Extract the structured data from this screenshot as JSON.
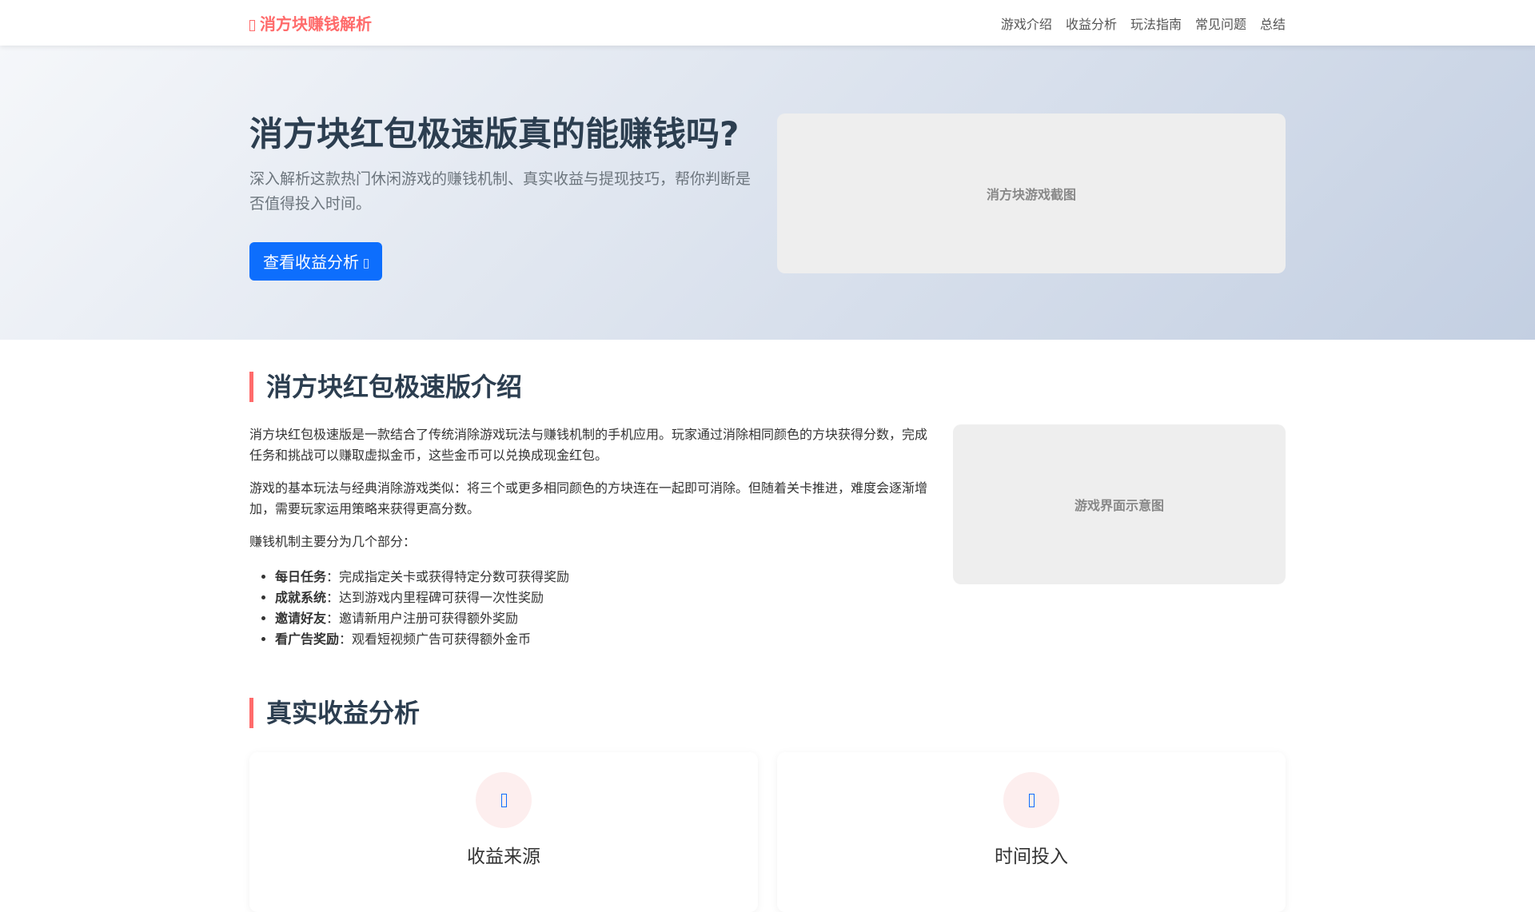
{
  "nav": {
    "logo": "消方块赚钱解析",
    "links": [
      "游戏介绍",
      "收益分析",
      "玩法指南",
      "常见问题",
      "总结"
    ]
  },
  "hero": {
    "title": "消方块红包极速版真的能赚钱吗?",
    "subtitle": "深入解析这款热门休闲游戏的赚钱机制、真实收益与提现技巧，帮你判断是否值得投入时间。",
    "button": "查看收益分析",
    "image_placeholder": "消方块游戏截图"
  },
  "intro": {
    "heading": "消方块红包极速版介绍",
    "paragraphs": [
      "消方块红包极速版是一款结合了传统消除游戏玩法与赚钱机制的手机应用。玩家通过消除相同颜色的方块获得分数，完成任务和挑战可以赚取虚拟金币，这些金币可以兑换成现金红包。",
      "游戏的基本玩法与经典消除游戏类似：将三个或更多相同颜色的方块连在一起即可消除。但随着关卡推进，难度会逐渐增加，需要玩家运用策略来获得更高分数。",
      "赚钱机制主要分为几个部分："
    ],
    "list": [
      {
        "term": "每日任务",
        "desc": "：完成指定关卡或获得特定分数可获得奖励"
      },
      {
        "term": "成就系统",
        "desc": "：达到游戏内里程碑可获得一次性奖励"
      },
      {
        "term": "邀请好友",
        "desc": "：邀请新用户注册可获得额外奖励"
      },
      {
        "term": "看广告奖励",
        "desc": "：观看短视频广告可获得额外金币"
      }
    ],
    "image_placeholder": "游戏界面示意图"
  },
  "earnings": {
    "heading": "真实收益分析",
    "cards": [
      {
        "title": "收益来源",
        "icon": "coin-icon"
      },
      {
        "title": "时间投入",
        "icon": "clock-icon"
      }
    ]
  },
  "colors": {
    "accent": "#ff6b6b",
    "primary": "#0d6efd"
  }
}
